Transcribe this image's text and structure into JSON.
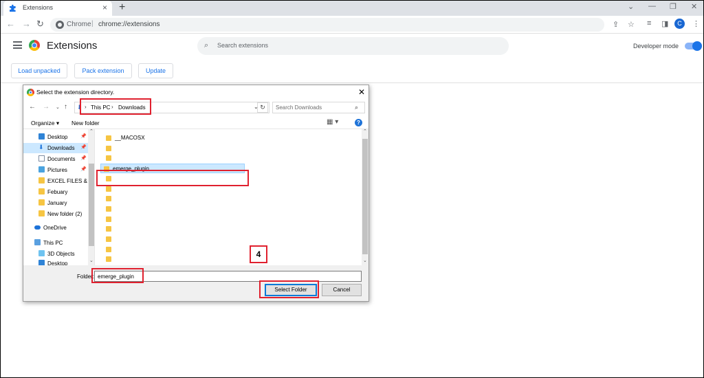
{
  "browser": {
    "tab_title": "Extensions",
    "new_tab": "+",
    "address_site": "Chrome",
    "address_sep": "|",
    "address_url": "chrome://extensions",
    "avatar_letter": "C",
    "window_controls": [
      "⌄",
      "—",
      "❐",
      "✕"
    ]
  },
  "extensions": {
    "title": "Extensions",
    "search_placeholder": "Search extensions",
    "developer_mode_label": "Developer mode",
    "developer_mode_on": true,
    "buttons": [
      "Load unpacked",
      "Pack extension",
      "Update"
    ]
  },
  "dialog": {
    "title": "Select the extension directory.",
    "breadcrumb": [
      "This PC",
      "Downloads"
    ],
    "search_placeholder": "Search Downloads",
    "organize_label": "Organize ▾",
    "new_folder_label": "New folder",
    "nav_items": [
      {
        "label": "Desktop",
        "icon": "desktop-icon",
        "pinned": true
      },
      {
        "label": "Downloads",
        "icon": "download-icon",
        "pinned": true,
        "selected": true
      },
      {
        "label": "Documents",
        "icon": "documents-icon",
        "pinned": true
      },
      {
        "label": "Pictures",
        "icon": "pictures-icon",
        "pinned": true
      },
      {
        "label": "EXCEL FILES & in",
        "icon": "folder-icon",
        "pinned": false
      },
      {
        "label": "Febuary",
        "icon": "folder-icon",
        "pinned": false
      },
      {
        "label": "January",
        "icon": "folder-icon",
        "pinned": false
      },
      {
        "label": "New folder (2)",
        "icon": "folder-icon",
        "pinned": false
      },
      {
        "label": "OneDrive",
        "icon": "onedrive-icon",
        "pinned": false
      },
      {
        "label": "This PC",
        "icon": "computer-icon",
        "pinned": false
      },
      {
        "label": "3D Objects",
        "icon": "3d-objects-icon",
        "pinned": false
      },
      {
        "label": "Desktop",
        "icon": "desktop-icon",
        "pinned": false
      }
    ],
    "files": [
      "__MACOSX",
      "",
      "",
      "emerge_plugin",
      "",
      "",
      "",
      "",
      "",
      "",
      "",
      "",
      ""
    ],
    "selected_file": "emerge_plugin",
    "folder_label": "Folder:",
    "folder_value": "emerge_plugin",
    "select_button": "Select Folder",
    "cancel_button": "Cancel"
  },
  "annotation": {
    "step_number": "4",
    "color": "#e0202e"
  }
}
